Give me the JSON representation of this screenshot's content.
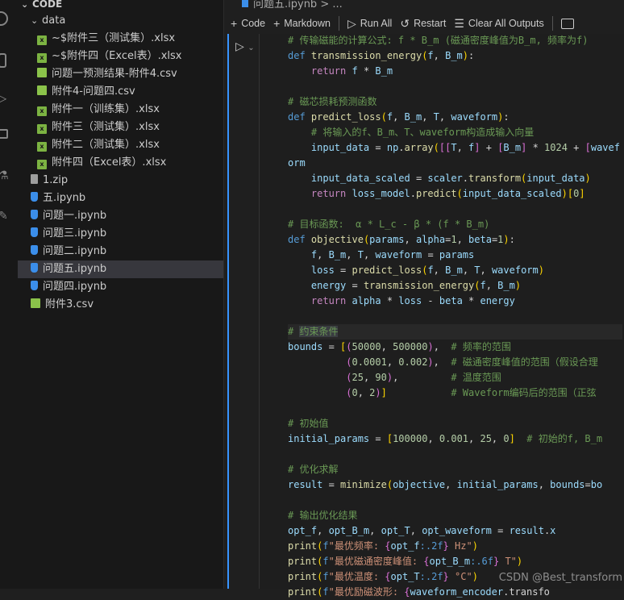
{
  "explorer": {
    "root": "CODE",
    "folder": "data",
    "items": [
      {
        "label": "~$附件三（测试集）.xlsx",
        "type": "xlsx",
        "depth": 2
      },
      {
        "label": "~$附件四（Excel表）.xlsx",
        "type": "xlsx",
        "depth": 2
      },
      {
        "label": "问题一预测结果-附件4.csv",
        "type": "csv",
        "depth": 2
      },
      {
        "label": "附件4-问题四.csv",
        "type": "csv",
        "depth": 2
      },
      {
        "label": "附件一（训练集）.xlsx",
        "type": "xlsx",
        "depth": 2
      },
      {
        "label": "附件三（测试集）.xlsx",
        "type": "xlsx",
        "depth": 2
      },
      {
        "label": "附件二（测试集）.xlsx",
        "type": "xlsx",
        "depth": 2
      },
      {
        "label": "附件四（Excel表）.xlsx",
        "type": "xlsx",
        "depth": 2
      },
      {
        "label": "1.zip",
        "type": "zip",
        "depth": 1
      },
      {
        "label": "五.ipynb",
        "type": "ipynb",
        "depth": 1
      },
      {
        "label": "问题一.ipynb",
        "type": "ipynb",
        "depth": 1
      },
      {
        "label": "问题三.ipynb",
        "type": "ipynb",
        "depth": 1
      },
      {
        "label": "问题二.ipynb",
        "type": "ipynb",
        "depth": 1
      },
      {
        "label": "问题五.ipynb",
        "type": "ipynb",
        "depth": 1,
        "selected": true
      },
      {
        "label": "问题四.ipynb",
        "type": "ipynb",
        "depth": 1
      },
      {
        "label": "附件3.csv",
        "type": "csv",
        "depth": 1
      }
    ]
  },
  "breadcrumb": "问题五.ipynb > ...",
  "toolbar": {
    "code": "Code",
    "markdown": "Markdown",
    "run_all": "Run All",
    "restart": "Restart",
    "clear": "Clear All Outputs"
  },
  "code_lines": [
    [
      [
        "cm",
        "# 传输磁能的计算公式: f * B_m (磁通密度峰值为B_m, 频率为f)"
      ]
    ],
    [
      [
        "kw",
        "def "
      ],
      [
        "fn",
        "transmission_energy"
      ],
      [
        "b1",
        "("
      ],
      [
        "v",
        "f"
      ],
      [
        "op",
        ", "
      ],
      [
        "v",
        "B_m"
      ],
      [
        "b1",
        ")"
      ],
      [
        "op",
        ":"
      ]
    ],
    [
      [
        "op",
        "    "
      ],
      [
        "ctl",
        "return "
      ],
      [
        "v",
        "f"
      ],
      [
        "op",
        " * "
      ],
      [
        "v",
        "B_m"
      ]
    ],
    [],
    [
      [
        "cm",
        "# 磁芯损耗预测函数"
      ]
    ],
    [
      [
        "kw",
        "def "
      ],
      [
        "fn",
        "predict_loss"
      ],
      [
        "b1",
        "("
      ],
      [
        "v",
        "f"
      ],
      [
        "op",
        ", "
      ],
      [
        "v",
        "B_m"
      ],
      [
        "op",
        ", "
      ],
      [
        "v",
        "T"
      ],
      [
        "op",
        ", "
      ],
      [
        "v",
        "waveform"
      ],
      [
        "b1",
        ")"
      ],
      [
        "op",
        ":"
      ]
    ],
    [
      [
        "op",
        "    "
      ],
      [
        "cm",
        "# 将输入的f、B_m、T、waveform构造成输入向量"
      ]
    ],
    [
      [
        "op",
        "    "
      ],
      [
        "v",
        "input_data"
      ],
      [
        "op",
        " = "
      ],
      [
        "v",
        "np"
      ],
      [
        "op",
        "."
      ],
      [
        "fn",
        "array"
      ],
      [
        "b1",
        "("
      ],
      [
        "b2",
        "[["
      ],
      [
        "v",
        "T"
      ],
      [
        "op",
        ", "
      ],
      [
        "v",
        "f"
      ],
      [
        "b2",
        "]"
      ],
      [
        "op",
        " + "
      ],
      [
        "b2",
        "["
      ],
      [
        "v",
        "B_m"
      ],
      [
        "b2",
        "]"
      ],
      [
        "op",
        " * "
      ],
      [
        "num",
        "1024"
      ],
      [
        "op",
        " + "
      ],
      [
        "b2",
        "["
      ],
      [
        "v",
        "waveform"
      ]
    ],
    [
      [
        "op",
        "    "
      ],
      [
        "v",
        "input_data_scaled"
      ],
      [
        "op",
        " = "
      ],
      [
        "v",
        "scaler"
      ],
      [
        "op",
        "."
      ],
      [
        "fn",
        "transform"
      ],
      [
        "b1",
        "("
      ],
      [
        "v",
        "input_data"
      ],
      [
        "b1",
        ")"
      ]
    ],
    [
      [
        "op",
        "    "
      ],
      [
        "ctl",
        "return "
      ],
      [
        "v",
        "loss_model"
      ],
      [
        "op",
        "."
      ],
      [
        "fn",
        "predict"
      ],
      [
        "b1",
        "("
      ],
      [
        "v",
        "input_data_scaled"
      ],
      [
        "b1",
        ")"
      ],
      [
        "b1",
        "["
      ],
      [
        "num",
        "0"
      ],
      [
        "b1",
        "]"
      ]
    ],
    [],
    [
      [
        "cm",
        "# 目标函数:  α * L_c - β * (f * B_m)"
      ]
    ],
    [
      [
        "kw",
        "def "
      ],
      [
        "fn",
        "objective"
      ],
      [
        "b1",
        "("
      ],
      [
        "v",
        "params"
      ],
      [
        "op",
        ", "
      ],
      [
        "v",
        "alpha"
      ],
      [
        "op",
        "="
      ],
      [
        "num",
        "1"
      ],
      [
        "op",
        ", "
      ],
      [
        "v",
        "beta"
      ],
      [
        "op",
        "="
      ],
      [
        "num",
        "1"
      ],
      [
        "b1",
        ")"
      ],
      [
        "op",
        ":"
      ]
    ],
    [
      [
        "op",
        "    "
      ],
      [
        "v",
        "f"
      ],
      [
        "op",
        ", "
      ],
      [
        "v",
        "B_m"
      ],
      [
        "op",
        ", "
      ],
      [
        "v",
        "T"
      ],
      [
        "op",
        ", "
      ],
      [
        "v",
        "waveform"
      ],
      [
        "op",
        " = "
      ],
      [
        "v",
        "params"
      ]
    ],
    [
      [
        "op",
        "    "
      ],
      [
        "v",
        "loss"
      ],
      [
        "op",
        " = "
      ],
      [
        "fn",
        "predict_loss"
      ],
      [
        "b1",
        "("
      ],
      [
        "v",
        "f"
      ],
      [
        "op",
        ", "
      ],
      [
        "v",
        "B_m"
      ],
      [
        "op",
        ", "
      ],
      [
        "v",
        "T"
      ],
      [
        "op",
        ", "
      ],
      [
        "v",
        "waveform"
      ],
      [
        "b1",
        ")"
      ]
    ],
    [
      [
        "op",
        "    "
      ],
      [
        "v",
        "energy"
      ],
      [
        "op",
        " = "
      ],
      [
        "fn",
        "transmission_energy"
      ],
      [
        "b1",
        "("
      ],
      [
        "v",
        "f"
      ],
      [
        "op",
        ", "
      ],
      [
        "v",
        "B_m"
      ],
      [
        "b1",
        ")"
      ]
    ],
    [
      [
        "op",
        "    "
      ],
      [
        "ctl",
        "return "
      ],
      [
        "v",
        "alpha"
      ],
      [
        "op",
        " * "
      ],
      [
        "v",
        "loss"
      ],
      [
        "op",
        " - "
      ],
      [
        "v",
        "beta"
      ],
      [
        "op",
        " * "
      ],
      [
        "v",
        "energy"
      ]
    ],
    [],
    [
      [
        "cm",
        "# "
      ],
      [
        "cm sel2",
        "约束条件"
      ]
    ],
    [
      [
        "v",
        "bounds"
      ],
      [
        "op",
        " = "
      ],
      [
        "b1",
        "["
      ],
      [
        "b2",
        "("
      ],
      [
        "num",
        "50000"
      ],
      [
        "op",
        ", "
      ],
      [
        "num",
        "500000"
      ],
      [
        "b2",
        ")"
      ],
      [
        "op",
        ",  "
      ],
      [
        "cm",
        "# 频率的范围"
      ]
    ],
    [
      [
        "op",
        "          "
      ],
      [
        "b2",
        "("
      ],
      [
        "num",
        "0.0001"
      ],
      [
        "op",
        ", "
      ],
      [
        "num",
        "0.002"
      ],
      [
        "b2",
        ")"
      ],
      [
        "op",
        ",  "
      ],
      [
        "cm",
        "# 磁通密度峰值的范围（假设合理"
      ]
    ],
    [
      [
        "op",
        "          "
      ],
      [
        "b2",
        "("
      ],
      [
        "num",
        "25"
      ],
      [
        "op",
        ", "
      ],
      [
        "num",
        "90"
      ],
      [
        "b2",
        ")"
      ],
      [
        "op",
        ",         "
      ],
      [
        "cm",
        "# 温度范围"
      ]
    ],
    [
      [
        "op",
        "          "
      ],
      [
        "b2",
        "("
      ],
      [
        "num",
        "0"
      ],
      [
        "op",
        ", "
      ],
      [
        "num",
        "2"
      ],
      [
        "b2",
        ")"
      ],
      [
        "b1",
        "]"
      ],
      [
        "op",
        "           "
      ],
      [
        "cm",
        "# Waveform编码后的范围（正弦"
      ]
    ],
    [],
    [
      [
        "cm",
        "# 初始值"
      ]
    ],
    [
      [
        "v",
        "initial_params"
      ],
      [
        "op",
        " = "
      ],
      [
        "b1",
        "["
      ],
      [
        "num",
        "100000"
      ],
      [
        "op",
        ", "
      ],
      [
        "num",
        "0.001"
      ],
      [
        "op",
        ", "
      ],
      [
        "num",
        "25"
      ],
      [
        "op",
        ", "
      ],
      [
        "num",
        "0"
      ],
      [
        "b1",
        "]"
      ],
      [
        "op",
        "  "
      ],
      [
        "cm",
        "# 初始的f, B_m"
      ]
    ],
    [],
    [
      [
        "cm",
        "# 优化求解"
      ]
    ],
    [
      [
        "v",
        "result"
      ],
      [
        "op",
        " = "
      ],
      [
        "fn",
        "minimize"
      ],
      [
        "b1",
        "("
      ],
      [
        "v",
        "objective"
      ],
      [
        "op",
        ", "
      ],
      [
        "v",
        "initial_params"
      ],
      [
        "op",
        ", "
      ],
      [
        "v",
        "bounds"
      ],
      [
        "op",
        "="
      ],
      [
        "v",
        "bo"
      ]
    ],
    [],
    [
      [
        "cm",
        "# 输出优化结果"
      ]
    ],
    [
      [
        "v",
        "opt_f"
      ],
      [
        "op",
        ", "
      ],
      [
        "v",
        "opt_B_m"
      ],
      [
        "op",
        ", "
      ],
      [
        "v",
        "opt_T"
      ],
      [
        "op",
        ", "
      ],
      [
        "v",
        "opt_waveform"
      ],
      [
        "op",
        " = "
      ],
      [
        "v",
        "result"
      ],
      [
        "op",
        "."
      ],
      [
        "v",
        "x"
      ]
    ],
    [
      [
        "fn",
        "print"
      ],
      [
        "b1",
        "("
      ],
      [
        "kw",
        "f"
      ],
      [
        "str",
        "\"最优频率: "
      ],
      [
        "b2",
        "{"
      ],
      [
        "v",
        "opt_f"
      ],
      [
        "kw",
        ":.2f"
      ],
      [
        "b2",
        "}"
      ],
      [
        "str",
        " Hz\""
      ],
      [
        "b1",
        ")"
      ]
    ],
    [
      [
        "fn",
        "print"
      ],
      [
        "b1",
        "("
      ],
      [
        "kw",
        "f"
      ],
      [
        "str",
        "\"最优磁通密度峰值: "
      ],
      [
        "b2",
        "{"
      ],
      [
        "v",
        "opt_B_m"
      ],
      [
        "kw",
        ":.6f"
      ],
      [
        "b2",
        "}"
      ],
      [
        "str",
        " T\""
      ],
      [
        "b1",
        ")"
      ]
    ],
    [
      [
        "fn",
        "print"
      ],
      [
        "b1",
        "("
      ],
      [
        "kw",
        "f"
      ],
      [
        "str",
        "\"最优温度: "
      ],
      [
        "b2",
        "{"
      ],
      [
        "v",
        "opt_T"
      ],
      [
        "kw",
        ":.2f"
      ],
      [
        "b2",
        "}"
      ],
      [
        "str",
        " °C\""
      ],
      [
        "b1",
        ")"
      ]
    ],
    [
      [
        "fn",
        "print"
      ],
      [
        "b1",
        "("
      ],
      [
        "kw",
        "f"
      ],
      [
        "str",
        "\"最优励磁波形: "
      ],
      [
        "b2",
        "{"
      ],
      [
        "v",
        "waveform_encoder"
      ],
      [
        "op",
        ".transfo"
      ]
    ]
  ],
  "watermark": "CSDN @Best_transform"
}
